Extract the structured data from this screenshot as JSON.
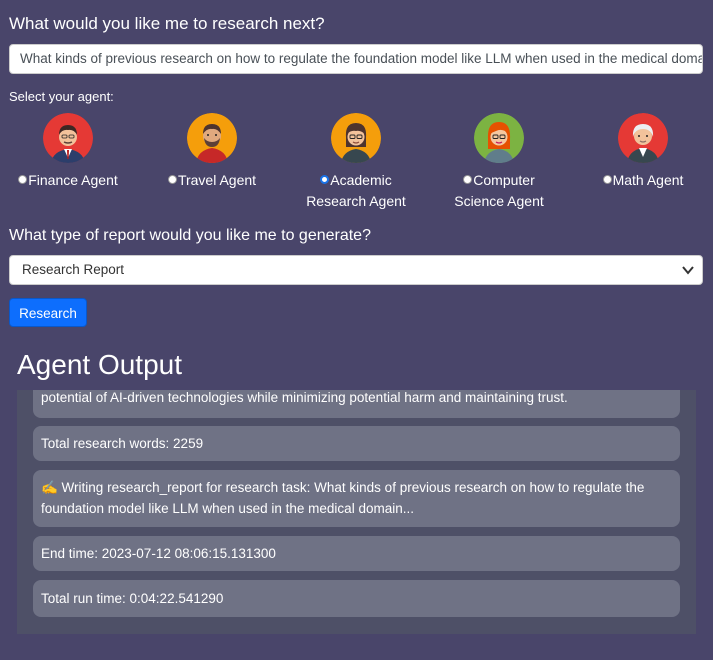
{
  "header": {
    "question": "What would you like me to research next?",
    "task_value": "What kinds of previous research on how to regulate  the foundation model like LLM when used in the medical domain"
  },
  "agent_select": {
    "label": "Select your agent:",
    "agents": [
      {
        "name": "Finance Agent",
        "icon": "finance-agent-avatar",
        "bg": "#e53935",
        "selected": false
      },
      {
        "name": "Travel Agent",
        "icon": "travel-agent-avatar",
        "bg": "#f59e0b",
        "selected": false
      },
      {
        "name": "Academic Research Agent",
        "line1": "Academic",
        "line2": "Research Agent",
        "icon": "academic-agent-avatar",
        "bg": "#f59e0b",
        "selected": true
      },
      {
        "name": "Computer Science Agent",
        "line1": "Computer",
        "line2": "Science Agent",
        "icon": "cs-agent-avatar",
        "bg": "#7cb342",
        "selected": false
      },
      {
        "name": "Math Agent",
        "icon": "math-agent-avatar",
        "bg": "#e53935",
        "selected": false
      }
    ]
  },
  "report": {
    "label": "What type of report would you like me to generate?",
    "selected": "Research Report"
  },
  "research_button": "Research",
  "output": {
    "title": "Agent Output",
    "logs": [
      "potential of AI-driven technologies while minimizing potential harm and maintaining trust.",
      "Total research words: 2259",
      "✍️ Writing research_report for research task: What kinds of previous research on how to regulate the foundation model like LLM when used in the medical domain...",
      "End time: 2023-07-12 08:06:15.131300",
      "Total run time: 0:04:22.541290"
    ]
  }
}
